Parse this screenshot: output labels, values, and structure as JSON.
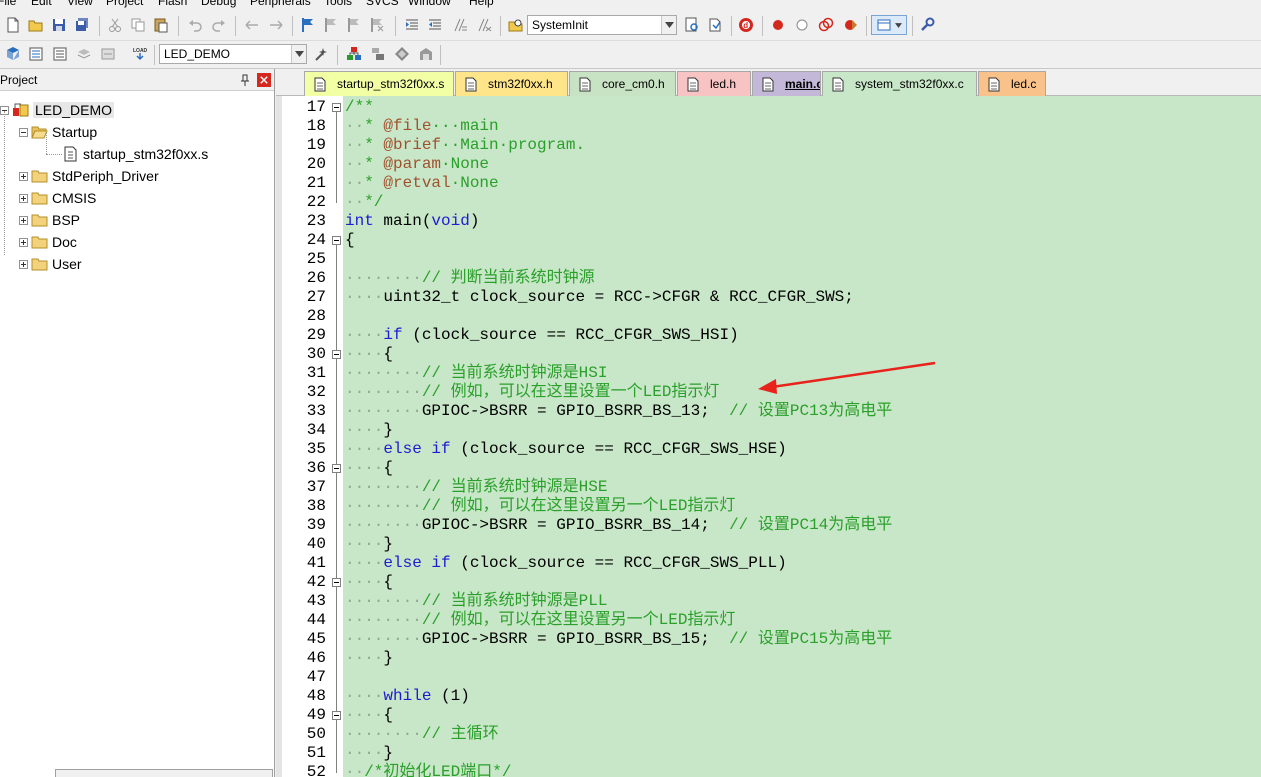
{
  "menu": [
    "File",
    "Edit",
    "View",
    "Project",
    "Flash",
    "Debug",
    "Peripherals",
    "Tools",
    "SVCS",
    "Window",
    "Help"
  ],
  "toolbar": {
    "target_combo": "SystemInit",
    "project_combo": "LED_DEMO"
  },
  "project_panel": {
    "title": "Project",
    "tree": {
      "root": "LED_DEMO",
      "groups": [
        "Startup",
        "StdPeriph_Driver",
        "CMSIS",
        "BSP",
        "Doc",
        "User"
      ],
      "startup_file": "startup_stm32f0xx.s"
    }
  },
  "tabs": [
    {
      "label": "startup_stm32f0xx.s",
      "color": "#f3ffa5",
      "active": false
    },
    {
      "label": "stm32f0xx.h",
      "color": "#ffe58a",
      "active": false
    },
    {
      "label": "core_cm0.h",
      "color": "#c8e2c4",
      "active": false
    },
    {
      "label": "led.h",
      "color": "#f7c3c3",
      "active": false
    },
    {
      "label": "main.c",
      "color": "#c4b8d8",
      "active": true
    },
    {
      "label": "system_stm32f0xx.c",
      "color": "#c8e6c8",
      "active": false
    },
    {
      "label": "led.c",
      "color": "#f8c28a",
      "active": false
    }
  ],
  "colors": {
    "editor_bg": "#c8e6c8",
    "comment": "#2aa02a",
    "keyword": "#1c1cd2",
    "doctag": "#a0522d",
    "arrow": "#e8231b"
  },
  "code": {
    "first_line": 17,
    "lines": [
      [
        [
          "comment",
          "/**"
        ]
      ],
      [
        [
          "ws",
          "··"
        ],
        [
          "comment",
          "* "
        ],
        [
          "doctag",
          "@file"
        ],
        [
          "comment",
          "···main"
        ]
      ],
      [
        [
          "ws",
          "··"
        ],
        [
          "comment",
          "* "
        ],
        [
          "doctag",
          "@brief"
        ],
        [
          "comment",
          "··Main·program."
        ]
      ],
      [
        [
          "ws",
          "··"
        ],
        [
          "comment",
          "* "
        ],
        [
          "doctag",
          "@param"
        ],
        [
          "comment",
          "·None"
        ]
      ],
      [
        [
          "ws",
          "··"
        ],
        [
          "comment",
          "* "
        ],
        [
          "doctag",
          "@retval"
        ],
        [
          "comment",
          "·None"
        ]
      ],
      [
        [
          "ws",
          "··"
        ],
        [
          "comment",
          "*/"
        ]
      ],
      [
        [
          "kw",
          "int"
        ],
        [
          "plain",
          " main("
        ],
        [
          "kw",
          "void"
        ],
        [
          "plain",
          ")"
        ]
      ],
      [
        [
          "plain",
          "{"
        ]
      ],
      [
        [
          "ws",
          ""
        ]
      ],
      [
        [
          "ws",
          "········"
        ],
        [
          "comment",
          "// 判断当前系统时钟源"
        ]
      ],
      [
        [
          "ws",
          "····"
        ],
        [
          "plain",
          "uint32_t clock_source = RCC->CFGR & RCC_CFGR_SWS;"
        ]
      ],
      [
        [
          "ws",
          ""
        ]
      ],
      [
        [
          "ws",
          "····"
        ],
        [
          "kw",
          "if"
        ],
        [
          "plain",
          " (clock_source == RCC_CFGR_SWS_HSI)"
        ]
      ],
      [
        [
          "ws",
          "····"
        ],
        [
          "plain",
          "{"
        ]
      ],
      [
        [
          "ws",
          "········"
        ],
        [
          "comment",
          "// 当前系统时钟源是HSI"
        ]
      ],
      [
        [
          "ws",
          "········"
        ],
        [
          "comment",
          "// 例如，可以在这里设置一个LED指示灯"
        ]
      ],
      [
        [
          "ws",
          "········"
        ],
        [
          "plain",
          "GPIOC->BSRR = GPIO_BSRR_BS_13; "
        ],
        [
          "comment",
          " // 设置PC13为高电平"
        ]
      ],
      [
        [
          "ws",
          "····"
        ],
        [
          "plain",
          "}"
        ]
      ],
      [
        [
          "ws",
          "····"
        ],
        [
          "kw",
          "else if"
        ],
        [
          "plain",
          " (clock_source == RCC_CFGR_SWS_HSE)"
        ]
      ],
      [
        [
          "ws",
          "····"
        ],
        [
          "plain",
          "{"
        ]
      ],
      [
        [
          "ws",
          "········"
        ],
        [
          "comment",
          "// 当前系统时钟源是HSE"
        ]
      ],
      [
        [
          "ws",
          "········"
        ],
        [
          "comment",
          "// 例如，可以在这里设置另一个LED指示灯"
        ]
      ],
      [
        [
          "ws",
          "········"
        ],
        [
          "plain",
          "GPIOC->BSRR = GPIO_BSRR_BS_14; "
        ],
        [
          "comment",
          " // 设置PC14为高电平"
        ]
      ],
      [
        [
          "ws",
          "····"
        ],
        [
          "plain",
          "}"
        ]
      ],
      [
        [
          "ws",
          "····"
        ],
        [
          "kw",
          "else if"
        ],
        [
          "plain",
          " (clock_source == RCC_CFGR_SWS_PLL)"
        ]
      ],
      [
        [
          "ws",
          "····"
        ],
        [
          "plain",
          "{"
        ]
      ],
      [
        [
          "ws",
          "········"
        ],
        [
          "comment",
          "// 当前系统时钟源是PLL"
        ]
      ],
      [
        [
          "ws",
          "········"
        ],
        [
          "comment",
          "// 例如，可以在这里设置另一个LED指示灯"
        ]
      ],
      [
        [
          "ws",
          "········"
        ],
        [
          "plain",
          "GPIOC->BSRR = GPIO_BSRR_BS_15; "
        ],
        [
          "comment",
          " // 设置PC15为高电平"
        ]
      ],
      [
        [
          "ws",
          "····"
        ],
        [
          "plain",
          "}"
        ]
      ],
      [
        [
          "ws",
          ""
        ]
      ],
      [
        [
          "ws",
          "····"
        ],
        [
          "kw",
          "while"
        ],
        [
          "plain",
          " (1)"
        ]
      ],
      [
        [
          "ws",
          "····"
        ],
        [
          "plain",
          "{"
        ]
      ],
      [
        [
          "ws",
          "········"
        ],
        [
          "comment",
          "// 主循环"
        ]
      ],
      [
        [
          "ws",
          "····"
        ],
        [
          "plain",
          "}"
        ]
      ],
      [
        [
          "ws",
          "··"
        ],
        [
          "comment",
          "/*初始化LED端口*/"
        ]
      ]
    ]
  }
}
